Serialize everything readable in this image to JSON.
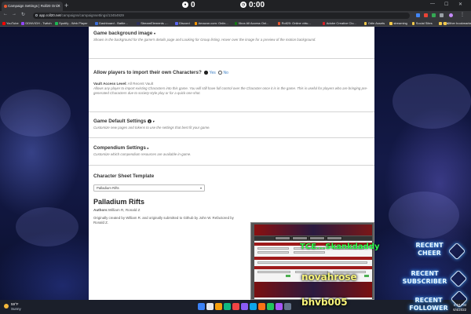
{
  "browser": {
    "tab_title": "Campaign Settings | Roll20 Onl...",
    "address_host": "app.roll20.net",
    "address_path": "/campaigns/campaignsettings/13454929",
    "bookmarks": [
      "YouTube",
      "DDNVIGH - Twitch",
      "Spotify - Web Player",
      "Dashboard - Battle...",
      "StreamElements -...",
      "Discord",
      "Amazon.com: Onlin...",
      "Xbox All Access Onl...",
      "Roll20: Online virtu...",
      "Adobe Creative Clo...",
      "Odin Assets",
      "streaming",
      "Social Sites",
      "Bills",
      "Other bookmarks"
    ],
    "bookmark_colors": [
      "#ff0000",
      "#9146ff",
      "#1db954",
      "#3a6dd8",
      "#2c2f5b",
      "#5865f2",
      "#ff9900",
      "#107c10",
      "#e8562f",
      "#da1f26",
      "#f2c94c",
      "#f2c94c",
      "#f2c94c",
      "#f2c94c",
      "#f2c94c"
    ]
  },
  "overlay_timer": {
    "count_left": "0",
    "count_right": "0:00"
  },
  "settings": {
    "background": {
      "title": "Game background image",
      "description": "Shown in the background for the game's details page and Looking for Group listing. Hover over the image for a preview of the motion background."
    },
    "import_characters": {
      "title": "Allow players to import their own Characters?",
      "yes_label": "Yes",
      "no_label": "No",
      "selected": "Yes",
      "vault_label": "Vault Access Level:",
      "vault_value": "All Recent Vault",
      "description": "Allows any player to import existing Characters into this game. You will still have full control over the Character once it is in the game. This is useful for players who are bringing pre-generated Characters due to society-style play or for a quick one-shot."
    },
    "game_defaults": {
      "title": "Game Default Settings",
      "description": "Customize new pages and tokens to use the settings that best fit your game."
    },
    "compendium": {
      "title": "Compendium Settings",
      "description": "Customize which compendium resources are available in-game."
    },
    "sheet_template": {
      "title": "Character Sheet Template",
      "selected": "Palladium Rifts"
    },
    "template_info": {
      "name": "Palladium Rifts",
      "authors_label": "Authors",
      "authors": "William R, Ronald Z",
      "description": "Originally created by William R. and originally submitted to Github by John W. Refactored by Ronald Z."
    }
  },
  "stream_overlays": {
    "alert_name_1": "TCE...Skankdaddy",
    "alert_name_2": "novahrose",
    "alert_name_3": "bhvb005",
    "recent_cheer": [
      "RECENT",
      "CHEER"
    ],
    "recent_subscriber": [
      "RECENT",
      "SUBSCRIBER"
    ],
    "recent_follower": [
      "RECENT",
      "FOLLOWER"
    ]
  },
  "taskbar": {
    "temperature": "59°F",
    "condition": "Sunny",
    "time": "8:04 PM",
    "date": "6/4/2022",
    "app_colors": [
      "#3b82f6",
      "#e5e7eb",
      "#f59e0b",
      "#10b981",
      "#ef4444",
      "#8b5cf6",
      "#0ea5e9",
      "#f97316",
      "#22c55e",
      "#a855f7",
      "#64748b"
    ]
  }
}
